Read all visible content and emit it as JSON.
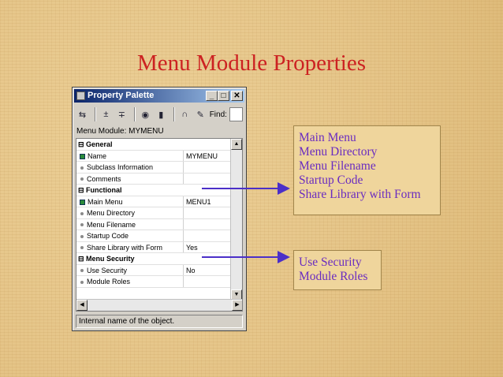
{
  "slide": {
    "title": "Menu Module Properties"
  },
  "window": {
    "title": "Property Palette",
    "find_label": "Find:",
    "module_label": "Menu Module:",
    "module_name": "MYMENU",
    "hint": "Internal name of the object."
  },
  "properties": {
    "general": {
      "label": "General",
      "name": {
        "label": "Name",
        "value": "MYMENU"
      },
      "subclass": {
        "label": "Subclass Information",
        "value": ""
      },
      "comments": {
        "label": "Comments",
        "value": ""
      }
    },
    "functional": {
      "label": "Functional",
      "main_menu": {
        "label": "Main Menu",
        "value": "MENU1"
      },
      "menu_directory": {
        "label": "Menu Directory",
        "value": ""
      },
      "menu_filename": {
        "label": "Menu Filename",
        "value": ""
      },
      "startup_code": {
        "label": "Startup Code",
        "value": ""
      },
      "share_library": {
        "label": "Share Library with Form",
        "value": "Yes"
      }
    },
    "security": {
      "label": "Menu Security",
      "use_security": {
        "label": "Use Security",
        "value": "No"
      },
      "module_roles": {
        "label": "Module Roles",
        "value": ""
      }
    }
  },
  "callouts": {
    "functional_items": [
      "Main Menu",
      "Menu Directory",
      "Menu Filename",
      "Startup Code",
      "Share Library with Form"
    ],
    "security_items": [
      "Use Security",
      "Module Roles"
    ]
  },
  "colors": {
    "title": "#cc2222",
    "callout_text": "#6a2cc0",
    "arrow": "#4b2fc8"
  }
}
